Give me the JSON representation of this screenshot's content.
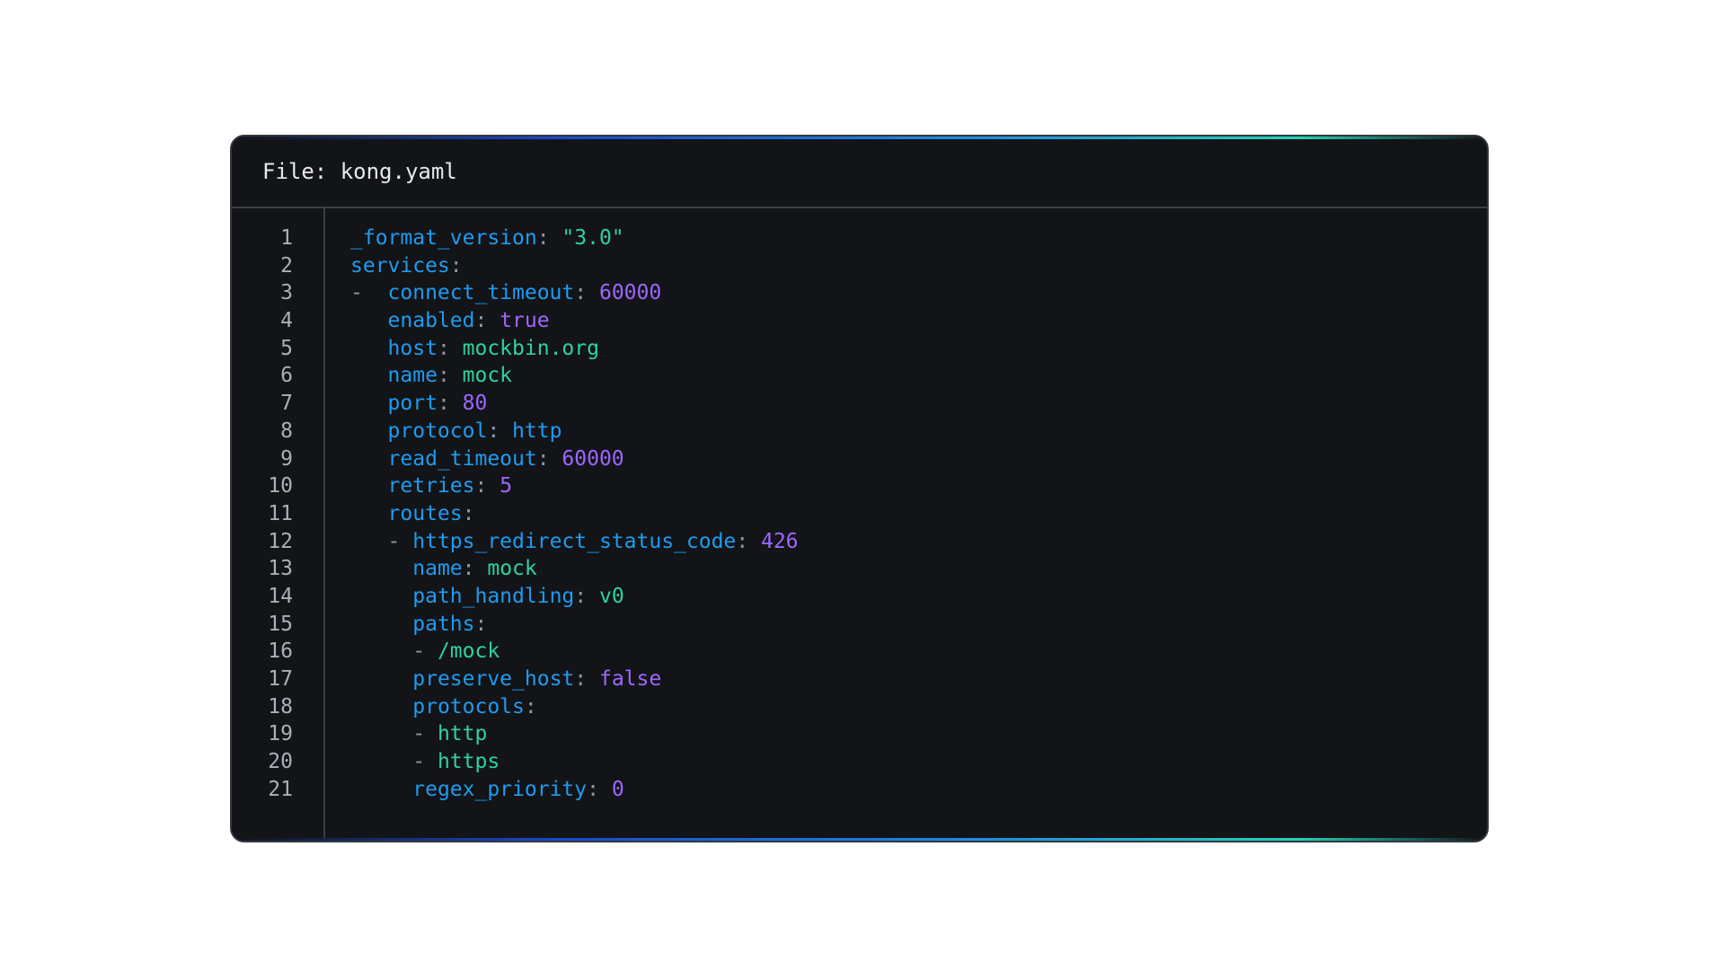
{
  "file_header": "File: kong.yaml",
  "colors": {
    "background": "#121418",
    "key": "#1f9bef",
    "string": "#2fd39a",
    "number": "#9f66ff",
    "punctuation": "#8a98a8",
    "line_number": "#aab0b8",
    "accent_gradient": [
      "#1a47c8",
      "#1f8de0",
      "#22d3b6"
    ]
  },
  "lines": [
    {
      "n": "1",
      "tokens": [
        [
          "key",
          "_format_version"
        ],
        [
          "punct",
          ": "
        ],
        [
          "str",
          "\"3.0\""
        ]
      ]
    },
    {
      "n": "2",
      "tokens": [
        [
          "key",
          "services"
        ],
        [
          "punct",
          ":"
        ]
      ]
    },
    {
      "n": "3",
      "tokens": [
        [
          "dash",
          "-  "
        ],
        [
          "key",
          "connect_timeout"
        ],
        [
          "punct",
          ": "
        ],
        [
          "num",
          "60000"
        ]
      ]
    },
    {
      "n": "4",
      "tokens": [
        [
          "plain",
          "   "
        ],
        [
          "key",
          "enabled"
        ],
        [
          "punct",
          ": "
        ],
        [
          "bool",
          "true"
        ]
      ]
    },
    {
      "n": "5",
      "tokens": [
        [
          "plain",
          "   "
        ],
        [
          "key",
          "host"
        ],
        [
          "punct",
          ": "
        ],
        [
          "str",
          "mockbin.org"
        ]
      ]
    },
    {
      "n": "6",
      "tokens": [
        [
          "plain",
          "   "
        ],
        [
          "key",
          "name"
        ],
        [
          "punct",
          ": "
        ],
        [
          "str",
          "mock"
        ]
      ]
    },
    {
      "n": "7",
      "tokens": [
        [
          "plain",
          "   "
        ],
        [
          "key",
          "port"
        ],
        [
          "punct",
          ": "
        ],
        [
          "num",
          "80"
        ]
      ]
    },
    {
      "n": "8",
      "tokens": [
        [
          "plain",
          "   "
        ],
        [
          "key",
          "protocol"
        ],
        [
          "punct",
          ": "
        ],
        [
          "key",
          "http"
        ]
      ]
    },
    {
      "n": "9",
      "tokens": [
        [
          "plain",
          "   "
        ],
        [
          "key",
          "read_timeout"
        ],
        [
          "punct",
          ": "
        ],
        [
          "num",
          "60000"
        ]
      ]
    },
    {
      "n": "10",
      "tokens": [
        [
          "plain",
          "   "
        ],
        [
          "key",
          "retries"
        ],
        [
          "punct",
          ": "
        ],
        [
          "num",
          "5"
        ]
      ]
    },
    {
      "n": "11",
      "tokens": [
        [
          "plain",
          "   "
        ],
        [
          "key",
          "routes"
        ],
        [
          "punct",
          ":"
        ]
      ]
    },
    {
      "n": "12",
      "tokens": [
        [
          "plain",
          "   "
        ],
        [
          "dash",
          "- "
        ],
        [
          "key",
          "https_redirect_status_code"
        ],
        [
          "punct",
          ": "
        ],
        [
          "num",
          "426"
        ]
      ]
    },
    {
      "n": "13",
      "tokens": [
        [
          "plain",
          "     "
        ],
        [
          "key",
          "name"
        ],
        [
          "punct",
          ": "
        ],
        [
          "str",
          "mock"
        ]
      ]
    },
    {
      "n": "14",
      "tokens": [
        [
          "plain",
          "     "
        ],
        [
          "key",
          "path_handling"
        ],
        [
          "punct",
          ": "
        ],
        [
          "str",
          "v0"
        ]
      ]
    },
    {
      "n": "15",
      "tokens": [
        [
          "plain",
          "     "
        ],
        [
          "key",
          "paths"
        ],
        [
          "punct",
          ":"
        ]
      ]
    },
    {
      "n": "16",
      "tokens": [
        [
          "plain",
          "     "
        ],
        [
          "dash",
          "- "
        ],
        [
          "str",
          "/mock"
        ]
      ]
    },
    {
      "n": "17",
      "tokens": [
        [
          "plain",
          "     "
        ],
        [
          "key",
          "preserve_host"
        ],
        [
          "punct",
          ": "
        ],
        [
          "bool",
          "false"
        ]
      ]
    },
    {
      "n": "18",
      "tokens": [
        [
          "plain",
          "     "
        ],
        [
          "key",
          "protocols"
        ],
        [
          "punct",
          ":"
        ]
      ]
    },
    {
      "n": "19",
      "tokens": [
        [
          "plain",
          "     "
        ],
        [
          "dash",
          "- "
        ],
        [
          "str",
          "http"
        ]
      ]
    },
    {
      "n": "20",
      "tokens": [
        [
          "plain",
          "     "
        ],
        [
          "dash",
          "- "
        ],
        [
          "str",
          "https"
        ]
      ]
    },
    {
      "n": "21",
      "tokens": [
        [
          "plain",
          "     "
        ],
        [
          "key",
          "regex_priority"
        ],
        [
          "punct",
          ": "
        ],
        [
          "num",
          "0"
        ]
      ]
    }
  ]
}
